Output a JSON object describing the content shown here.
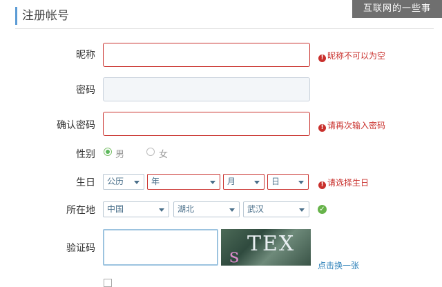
{
  "header": {
    "title": "注册帐号"
  },
  "watermark": "互联网的一些事",
  "form": {
    "nickname": {
      "label": "昵称",
      "value": "",
      "error": "昵称不可以为空"
    },
    "password": {
      "label": "密码",
      "value": ""
    },
    "confirm_password": {
      "label": "确认密码",
      "value": "",
      "error": "请再次输入密码"
    },
    "gender": {
      "label": "性别",
      "options": [
        "男",
        "女"
      ],
      "selected": "男"
    },
    "birthday": {
      "label": "生日",
      "calendar": "公历",
      "year": "年",
      "month": "月",
      "day": "日",
      "error": "请选择生日"
    },
    "location": {
      "label": "所在地",
      "country": "中国",
      "province": "湖北",
      "city": "武汉"
    },
    "captcha": {
      "label": "验证码",
      "value": "",
      "image_text": "TEX",
      "image_s": "s",
      "refresh": "点击换一张"
    }
  },
  "colors": {
    "accent": "#5b9bd5",
    "error": "#c9302c",
    "ok": "#67b34a",
    "link": "#2a7fb8"
  }
}
